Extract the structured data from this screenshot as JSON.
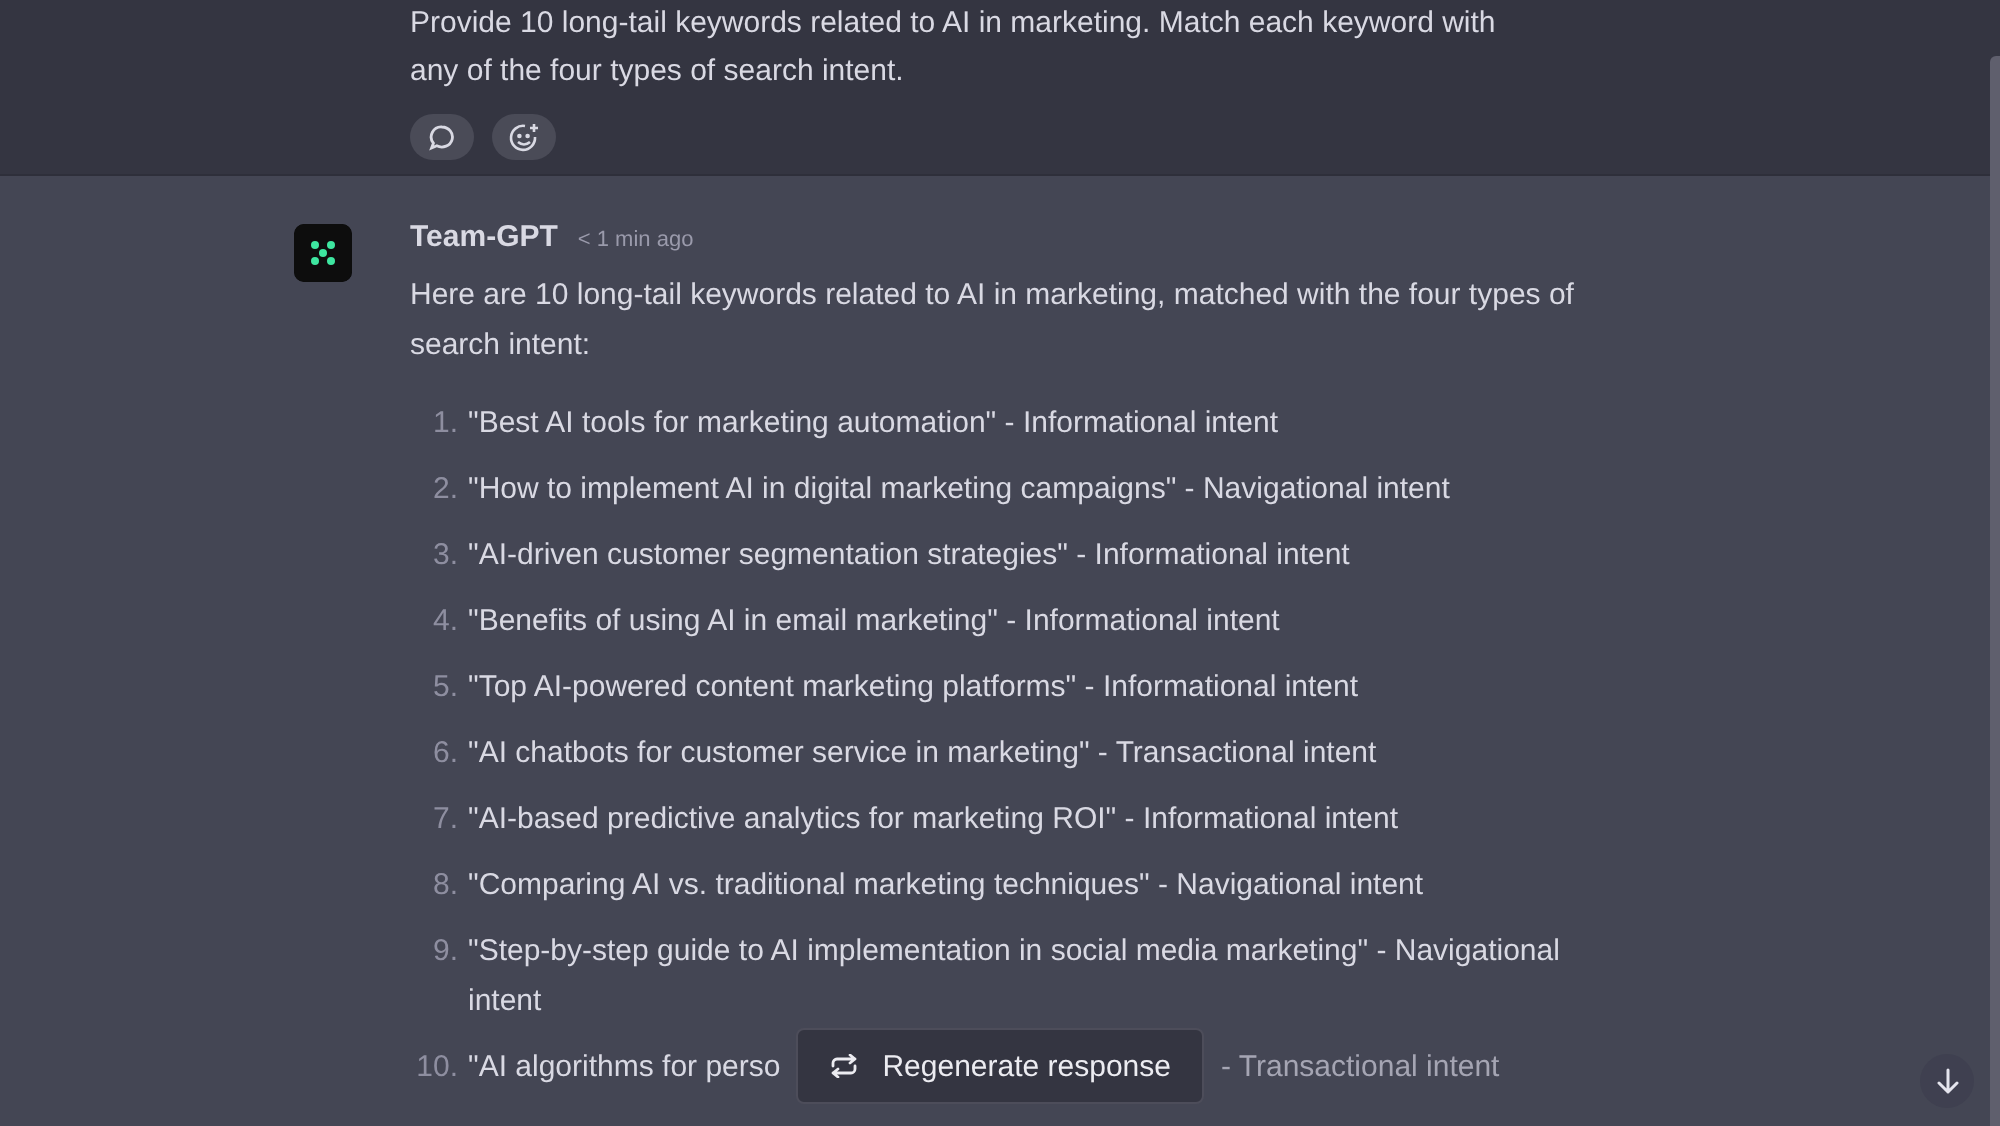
{
  "prompt": {
    "lines": [
      "Provide 10 long-tail keywords related to AI in marketing. Match each keyword with",
      "any of the four types of search intent."
    ]
  },
  "reply": {
    "author": "Team-GPT",
    "time": "< 1 min ago",
    "intro": "Here are 10 long-tail keywords related to AI in marketing, matched with the four types of search intent:",
    "items": [
      {
        "number": "1.",
        "text": "\"Best AI tools for marketing automation\" - Informational intent"
      },
      {
        "number": "2.",
        "text": "\"How to implement AI in digital marketing campaigns\" - Navigational intent"
      },
      {
        "number": "3.",
        "text": "\"AI-driven customer segmentation strategies\" - Informational intent"
      },
      {
        "number": "4.",
        "text": "\"Benefits of using AI in email marketing\" - Informational intent"
      },
      {
        "number": "5.",
        "text": "\"Top AI-powered content marketing platforms\" - Informational intent"
      },
      {
        "number": "6.",
        "text": "\"AI chatbots for customer service in marketing\" - Transactional intent"
      },
      {
        "number": "7.",
        "text": "\"AI-based predictive analytics for marketing ROI\" - Informational intent"
      },
      {
        "number": "8.",
        "text": "\"Comparing AI vs. traditional marketing techniques\" - Navigational intent"
      },
      {
        "number": "9.",
        "text": "\"Step-by-step guide to AI implementation in social media marketing\" - Navigational intent"
      },
      {
        "number": "10.",
        "text": "\"AI algorithms for perso",
        "text_after": "- Transactional intent"
      }
    ]
  },
  "regenerate_button": {
    "label": "Regenerate response"
  }
}
